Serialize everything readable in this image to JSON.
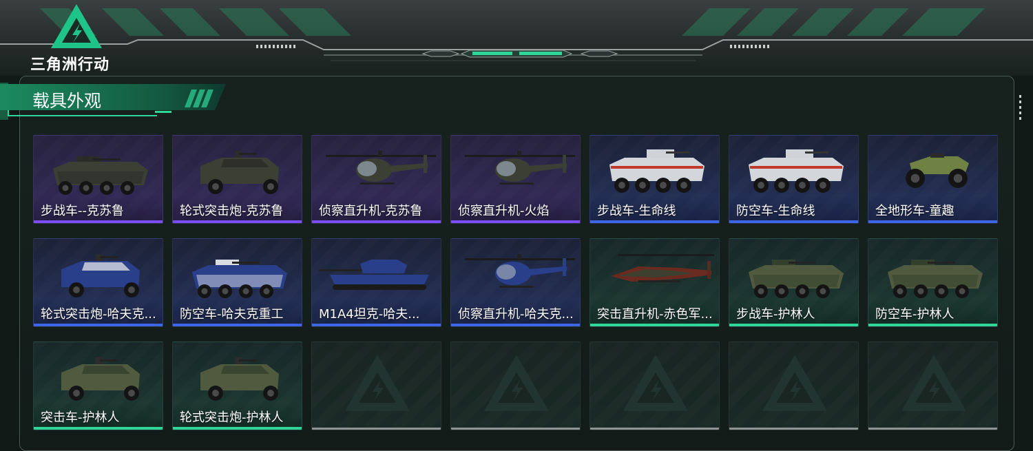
{
  "header": {
    "logo_text": "三角洲行动"
  },
  "panel": {
    "title": "载具外观"
  },
  "colors": {
    "accent_green": "#2fd69a",
    "rarity_purple": "#7a4df5",
    "rarity_blue": "#3d66e8",
    "rarity_green": "#2fd69a",
    "empty": "#8f9593"
  },
  "vehicles": [
    {
      "name": "步战车--克苏鲁",
      "rarity": "purple",
      "type": "ifv8",
      "icon": "eight-wheel-ifv-icon"
    },
    {
      "name": "轮式突击炮-克苏鲁",
      "rarity": "purple",
      "type": "armored-car",
      "icon": "wheeled-assault-gun-icon"
    },
    {
      "name": "侦察直升机-克苏鲁",
      "rarity": "purple",
      "type": "heli-small",
      "icon": "scout-helicopter-icon"
    },
    {
      "name": "侦察直升机-火焰",
      "rarity": "purple",
      "type": "heli-small",
      "icon": "scout-helicopter-icon"
    },
    {
      "name": "步战车-生命线",
      "rarity": "blue",
      "type": "ifv8-white",
      "icon": "eight-wheel-ifv-icon"
    },
    {
      "name": "防空车-生命线",
      "rarity": "blue",
      "type": "ifv8-white",
      "icon": "anti-air-vehicle-icon"
    },
    {
      "name": "全地形车-童趣",
      "rarity": "blue",
      "type": "atv",
      "icon": "atv-icon"
    },
    {
      "name": "轮式突击炮-哈夫克...",
      "rarity": "blue",
      "type": "armored-car",
      "icon": "wheeled-assault-gun-icon"
    },
    {
      "name": "防空车-哈夫克重工",
      "rarity": "blue",
      "type": "ifv8",
      "icon": "anti-air-vehicle-icon"
    },
    {
      "name": "M1A4坦克-哈夫...",
      "rarity": "blue",
      "type": "tank",
      "icon": "tank-icon"
    },
    {
      "name": "侦察直升机-哈夫克...",
      "rarity": "blue",
      "type": "heli-small",
      "icon": "scout-helicopter-icon"
    },
    {
      "name": "突击直升机-赤色军...",
      "rarity": "green",
      "type": "heli-attack",
      "icon": "attack-helicopter-icon"
    },
    {
      "name": "步战车-护林人",
      "rarity": "green",
      "type": "ifv8",
      "icon": "eight-wheel-ifv-icon"
    },
    {
      "name": "防空车-护林人",
      "rarity": "green",
      "type": "ifv8",
      "icon": "anti-air-vehicle-icon"
    },
    {
      "name": "突击车-护林人",
      "rarity": "green",
      "type": "armored-car",
      "icon": "assault-vehicle-icon"
    },
    {
      "name": "轮式突击炮-护林人",
      "rarity": "green",
      "type": "armored-car",
      "icon": "wheeled-assault-gun-icon"
    },
    {
      "name": "",
      "rarity": "empty",
      "type": "empty",
      "icon": "delta-watermark-icon"
    },
    {
      "name": "",
      "rarity": "empty",
      "type": "empty",
      "icon": "delta-watermark-icon"
    },
    {
      "name": "",
      "rarity": "empty",
      "type": "empty",
      "icon": "delta-watermark-icon"
    },
    {
      "name": "",
      "rarity": "empty",
      "type": "empty",
      "icon": "delta-watermark-icon"
    },
    {
      "name": "",
      "rarity": "empty",
      "type": "empty",
      "icon": "delta-watermark-icon"
    }
  ]
}
